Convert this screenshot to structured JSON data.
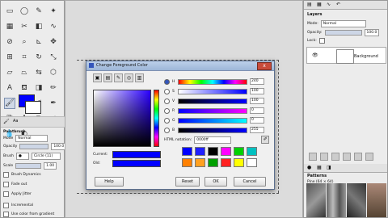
{
  "toolbox": {
    "tools": [
      "rect-select",
      "ellipse-select",
      "free-select",
      "fuzzy-select",
      "select-by-color",
      "scissors",
      "foreground-select",
      "paths",
      "color-picker",
      "zoom",
      "measure",
      "move",
      "align",
      "crop",
      "rotate",
      "scale",
      "shear",
      "perspective",
      "flip",
      "cage",
      "text",
      "bucket-fill",
      "blend",
      "pencil",
      "paintbrush",
      "eraser",
      "airbrush",
      "ink",
      "clone",
      "heal",
      "perspective-clone",
      "smudge",
      "blur",
      "dodge-burn"
    ],
    "fg_color": "#0000ff",
    "bg_color": "#ffffff",
    "options_title": "Paintbrush",
    "mode_label": "Mode",
    "mode_value": "Normal",
    "opacity_label": "Opacity",
    "opacity_value": "100.0",
    "brush_label": "Brush",
    "brush_value": "Circle (11)",
    "scale_label": "Scale",
    "scale_value": "1.00",
    "brush_dynamics_label": "Brush Dynamics",
    "fade_out_label": "Fade out",
    "apply_jitter_label": "Apply Jitter",
    "incremental_label": "Incremental",
    "use_color_label": "Use color from gradient"
  },
  "dialog": {
    "title": "Change Foreground Color",
    "close_label": "x",
    "channels": [
      {
        "label": "H",
        "value": "240",
        "selected": true
      },
      {
        "label": "S",
        "value": "100",
        "selected": false
      },
      {
        "label": "V",
        "value": "100",
        "selected": false
      },
      {
        "label": "R",
        "value": "0",
        "selected": false
      },
      {
        "label": "G",
        "value": "0",
        "selected": false
      },
      {
        "label": "B",
        "value": "255",
        "selected": false
      }
    ],
    "html_notation_label": "HTML notation:",
    "html_notation_value": "0000ff",
    "current_label": "Current:",
    "old_label": "Old:",
    "swatches": [
      "#0000ff",
      "#2020ff",
      "#000000",
      "#ff00ff",
      "#00d000",
      "#00c0c0",
      "#ff8000",
      "#ffa020",
      "#00a000",
      "#ff2020",
      "#ffff00",
      "#ffffff"
    ],
    "buttons": {
      "help": "Help",
      "reset": "Reset",
      "ok": "OK",
      "cancel": "Cancel"
    }
  },
  "right_dock": {
    "layers_title": "Layers",
    "mode_label": "Mode:",
    "mode_value": "Normal",
    "opacity_label": "Opacity:",
    "opacity_value": "100.0",
    "lock_label": "Lock:",
    "layer_name": "Background",
    "patterns_title": "Patterns",
    "patterns_subtitle": "Pine (64 × 64)"
  }
}
